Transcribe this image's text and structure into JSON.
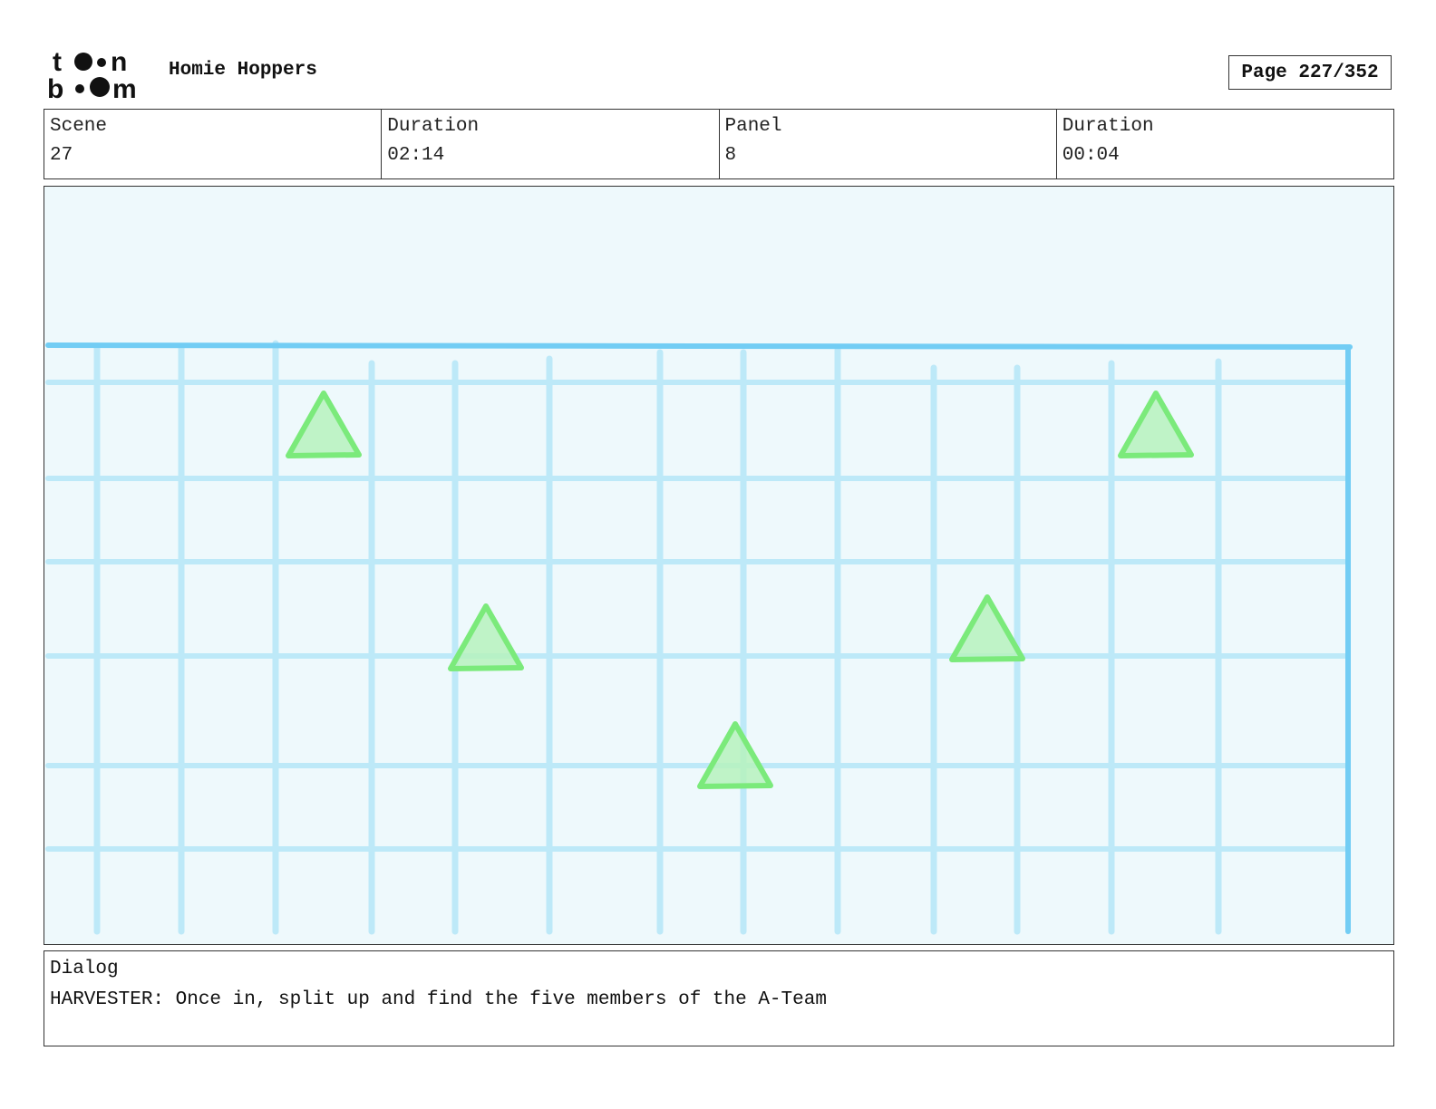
{
  "header": {
    "logo_text": "toon boom",
    "project_title": "Homie Hoppers",
    "page_indicator": "Page 227/352"
  },
  "info": {
    "scene_label": "Scene",
    "scene_value": "27",
    "scene_duration_label": "Duration",
    "scene_duration_value": "02:14",
    "panel_label": "Panel",
    "panel_value": "8",
    "panel_duration_label": "Duration",
    "panel_duration_value": "00:04"
  },
  "panel": {
    "background_color": "#eef9fc",
    "grid_color": "#bde9f8",
    "frame_line_color": "#72cdf4",
    "marker_color": "#7bea7b",
    "marker_fill": "#b6f2bd",
    "marker_shape": "triangle",
    "marker_count": 5
  },
  "dialog": {
    "label": "Dialog",
    "text": "HARVESTER: Once in, split up and find the five members of the A-Team"
  }
}
